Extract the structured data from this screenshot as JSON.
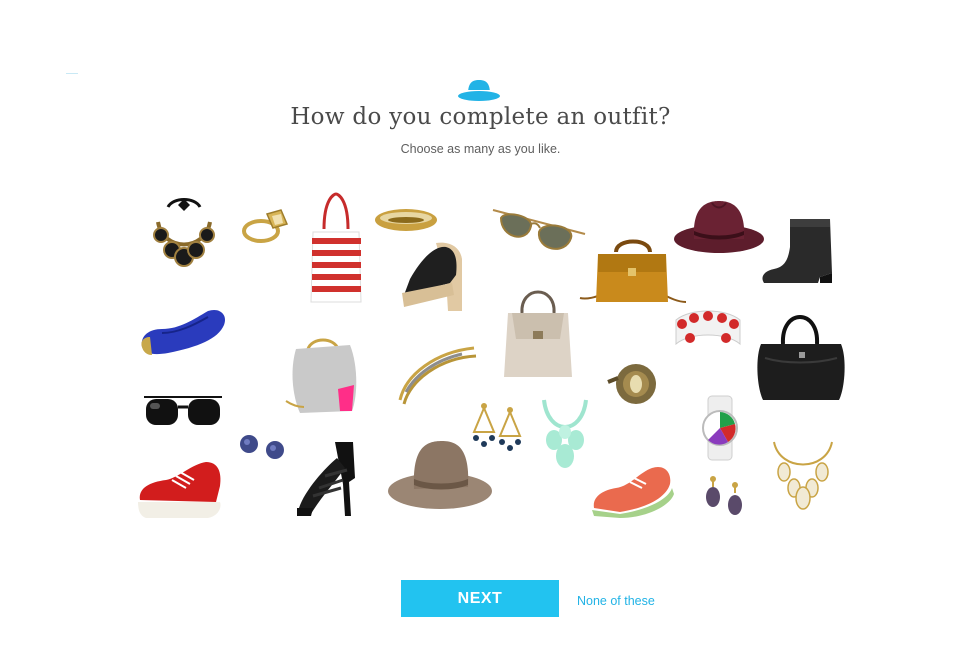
{
  "header": {
    "title": "How do you complete an outfit?",
    "subtitle": "Choose as many as you like.",
    "logo_icon": "hat-logo-icon",
    "accent_color": "#22c3f0"
  },
  "items": [
    "statement-necklace",
    "gold-ring",
    "striped-tote-bag",
    "gold-bangle",
    "aviator-sunglasses",
    "burgundy-fedora",
    "black-ankle-boot",
    "platform-heel",
    "mustard-crossbody-bag",
    "grey-satchel",
    "blue-loafer",
    "red-stud-bracelet",
    "black-leather-bag",
    "grey-clutch",
    "gold-chain-necklace",
    "horseshoe-ring",
    "black-sunglasses",
    "white-watch",
    "chandelier-earrings",
    "mint-necklace",
    "stud-earrings",
    "red-sneaker",
    "strappy-black-heel",
    "floppy-hat",
    "coral-oxford",
    "drop-earrings",
    "teardrop-necklace"
  ],
  "actions": {
    "next_label": "NEXT",
    "none_label": "None of these"
  }
}
